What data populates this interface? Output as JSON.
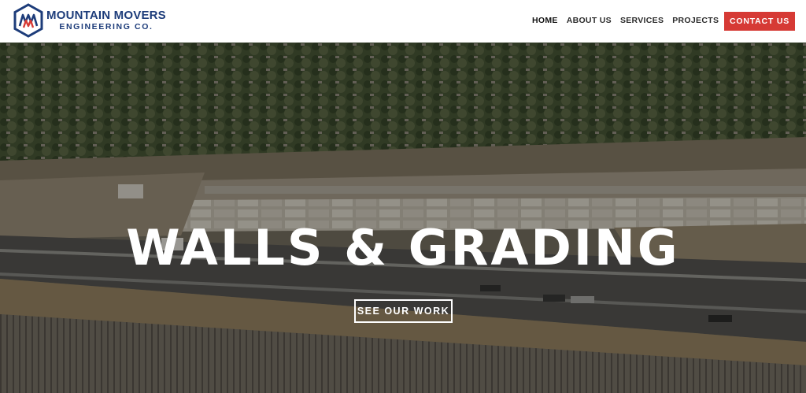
{
  "brand": {
    "name_line1": "MOUNTAIN MOVERS",
    "name_line2": "ENGINEERING CO.",
    "logo_icon": "mm-hexagon-logo",
    "primary_color": "#1d3c7a",
    "accent_color": "#d63a35"
  },
  "nav": {
    "items": [
      {
        "label": "HOME",
        "active": true
      },
      {
        "label": "ABOUT US",
        "active": false
      },
      {
        "label": "SERVICES",
        "active": false
      },
      {
        "label": "PROJECTS",
        "active": false
      }
    ],
    "contact_label": "CONTACT US"
  },
  "hero": {
    "title": "WALLS & GRADING",
    "cta_label": "SEE OUR WORK"
  }
}
